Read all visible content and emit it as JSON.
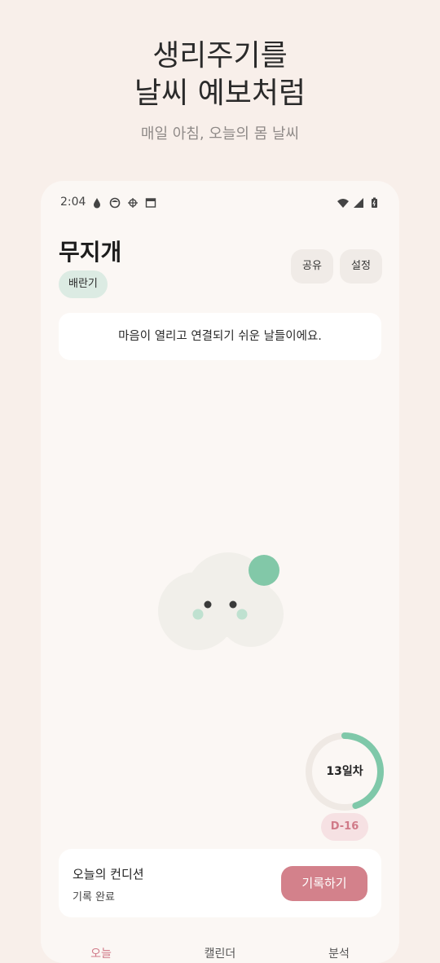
{
  "hero": {
    "title_line1": "생리주기를",
    "title_line2": "날씨 예보처럼",
    "subtitle": "매일 아침, 오늘의 몸 날씨"
  },
  "status_bar": {
    "time": "2:04"
  },
  "app": {
    "title": "무지개",
    "phase": "배란기",
    "share_label": "공유",
    "settings_label": "설정",
    "message": "마음이 열리고 연결되기 쉬운 날들이에요.",
    "cycle_day_label": "13일차",
    "dday": "D-16",
    "cycle_progress": 0.45
  },
  "condition": {
    "title": "오늘의 컨디션",
    "status": "기록 완료",
    "record_button": "기록하기"
  },
  "tabs": [
    {
      "label": "오늘"
    },
    {
      "label": "캘린더"
    },
    {
      "label": "분석"
    }
  ],
  "colors": {
    "background": "#f8efea",
    "accent_pink": "#d3818b",
    "accent_mint": "#7fc8a9",
    "badge_mint": "#dcebe3"
  }
}
